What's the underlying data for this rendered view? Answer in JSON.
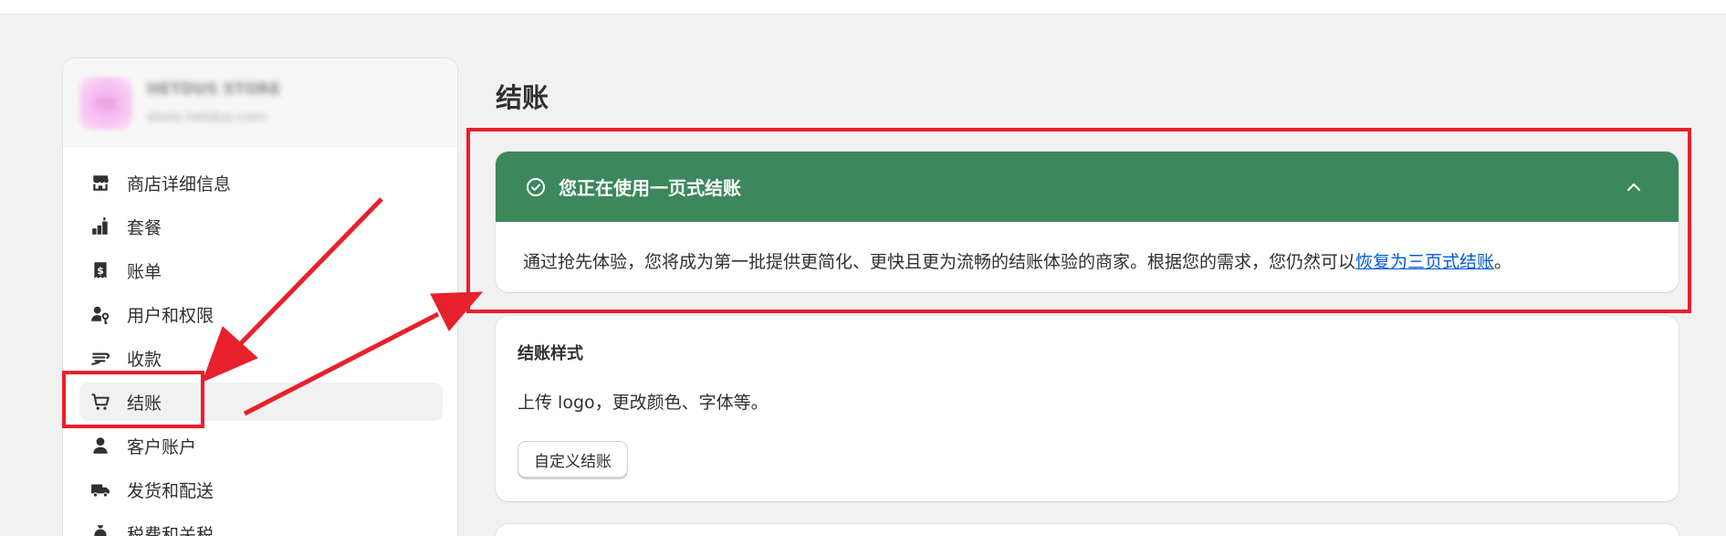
{
  "store": {
    "avatar_initials": "HE",
    "name": "HETDUS STORE",
    "domain": "store.hetdus.com"
  },
  "sidebar": {
    "items": [
      {
        "label": "商店详细信息",
        "icon": "store-icon"
      },
      {
        "label": "套餐",
        "icon": "plan-icon"
      },
      {
        "label": "账单",
        "icon": "billing-icon"
      },
      {
        "label": "用户和权限",
        "icon": "users-permissions-icon"
      },
      {
        "label": "收款",
        "icon": "payments-icon"
      },
      {
        "label": "结账",
        "icon": "cart-icon",
        "active": true
      },
      {
        "label": "客户账户",
        "icon": "customer-icon"
      },
      {
        "label": "发货和配送",
        "icon": "truck-icon"
      },
      {
        "label": "税费和关税",
        "icon": "tax-icon"
      }
    ]
  },
  "main": {
    "title": "结账",
    "banner": {
      "title": "您正在使用一页式结账",
      "body_text": "通过抢先体验，您将成为第一批提供更简化、更快且更为流畅的结账体验的商家。根据您的需求，您仍然可以",
      "link_text": "恢复为三页式结账",
      "body_end": "。",
      "color": "#3c875c"
    },
    "checkout_style": {
      "title": "结账样式",
      "description": "上传 logo，更改颜色、字体等。",
      "button_label": "自定义结账"
    }
  },
  "annotation": {
    "color": "#e8202c"
  }
}
